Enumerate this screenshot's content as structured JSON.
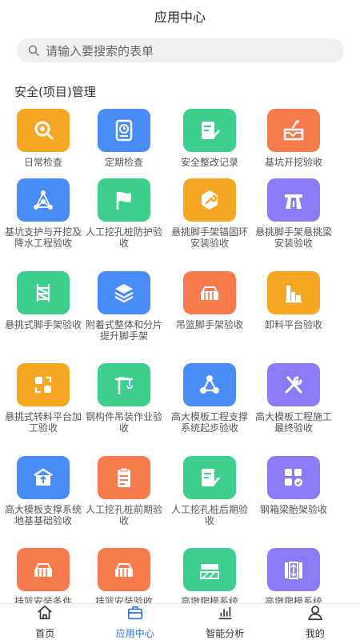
{
  "header": {
    "title": "应用中心"
  },
  "search": {
    "placeholder": "请输入要搜索的表单"
  },
  "section": {
    "title": "安全(项目)管理"
  },
  "colors": {
    "orange": "#f5a623",
    "blue": "#4a8cf6",
    "green": "#3ccf8e",
    "red": "#f77b4d",
    "purple": "#8b7cf6",
    "active": "#2f6fe0"
  },
  "apps": [
    {
      "label": "日常检查",
      "color": "orange",
      "icon": "search-magnifier-icon"
    },
    {
      "label": "定期检查",
      "color": "blue",
      "icon": "clock-doc-icon"
    },
    {
      "label": "安全整改记录",
      "color": "green",
      "icon": "edit-doc-icon"
    },
    {
      "label": "基坑开挖验收",
      "color": "red",
      "icon": "shovel-pit-icon"
    },
    {
      "label": "基坑支护与开挖及降水工程验收",
      "color": "blue",
      "icon": "network-icon"
    },
    {
      "label": "人工挖孔桩防护验收",
      "color": "green",
      "icon": "flag-icon"
    },
    {
      "label": "悬挑脚手架锚固环安装验收",
      "color": "orange",
      "icon": "wrench-badge-icon"
    },
    {
      "label": "悬挑脚手架悬挑梁安装验收",
      "color": "purple",
      "icon": "road-icon"
    },
    {
      "label": "悬挑式脚手架验收",
      "color": "green",
      "icon": "scaffold-icon"
    },
    {
      "label": "附着式整体和分片提升脚手架",
      "color": "blue",
      "icon": "layers-icon"
    },
    {
      "label": "吊篮脚手架验收",
      "color": "red",
      "icon": "basket-icon"
    },
    {
      "label": "卸料平台验收",
      "color": "orange",
      "icon": "platform-icon"
    },
    {
      "label": "悬挑式转料平台加工验收",
      "color": "orange",
      "icon": "transfer-icon"
    },
    {
      "label": "钢构件吊装作业验收",
      "color": "green",
      "icon": "crane-icon"
    },
    {
      "label": "高大模板工程支撑系统起步验收",
      "color": "blue",
      "icon": "nodes-icon"
    },
    {
      "label": "高大模板工程施工最终验收",
      "color": "purple",
      "icon": "tools-icon"
    },
    {
      "label": "高大模板支撑系统地基基础验收",
      "color": "blue",
      "icon": "foundation-icon"
    },
    {
      "label": "人工挖孔桩前期验收",
      "color": "red",
      "icon": "clipboard-icon"
    },
    {
      "label": "人工挖孔桩后期验收",
      "color": "green",
      "icon": "edit-doc-icon"
    },
    {
      "label": "钢箱梁胎架验收",
      "color": "purple",
      "icon": "grid-check-icon"
    },
    {
      "label": "挂篮安装条件",
      "color": "red",
      "icon": "basket-icon"
    },
    {
      "label": "挂篮安装验收",
      "color": "red",
      "icon": "basket-icon"
    },
    {
      "label": "高墩爬模系统",
      "color": "green",
      "icon": "formwork-icon"
    },
    {
      "label": "高墩爬模系统",
      "color": "purple",
      "icon": "climb-icon"
    }
  ],
  "tabs": [
    {
      "label": "首页",
      "icon": "home-icon",
      "active": false
    },
    {
      "label": "应用中心",
      "icon": "briefcase-icon",
      "active": true
    },
    {
      "label": "智能分析",
      "icon": "bar-chart-icon",
      "active": false
    },
    {
      "label": "我的",
      "icon": "user-icon",
      "active": false
    }
  ]
}
